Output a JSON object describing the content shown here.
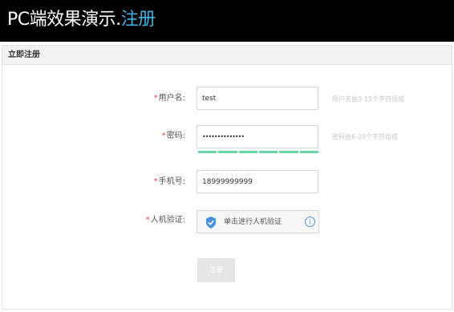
{
  "header": {
    "title_main": "PC端效果演示.",
    "title_accent": "注册",
    "accent_color": "#3fb3e6"
  },
  "panel": {
    "title": "立即注册"
  },
  "form": {
    "required_mark": "*",
    "username": {
      "label": "用户名:",
      "value": "test",
      "hint": "用户名由3-15个字符组成"
    },
    "password": {
      "label": "密码:",
      "value": "••••••••••••••",
      "hint": "密码由6-20个字符组成",
      "strength_segments": 6,
      "strength_filled": 6,
      "strength_color": "#6ad6a6"
    },
    "phone": {
      "label": "手机号:",
      "value": "18999999999"
    },
    "captcha": {
      "label": "人机验证:",
      "text": "单击进行人机验证",
      "shield_icon": "shield-check-icon",
      "info_icon": "info-icon",
      "info_glyph": "i"
    },
    "submit_label": "注册"
  }
}
